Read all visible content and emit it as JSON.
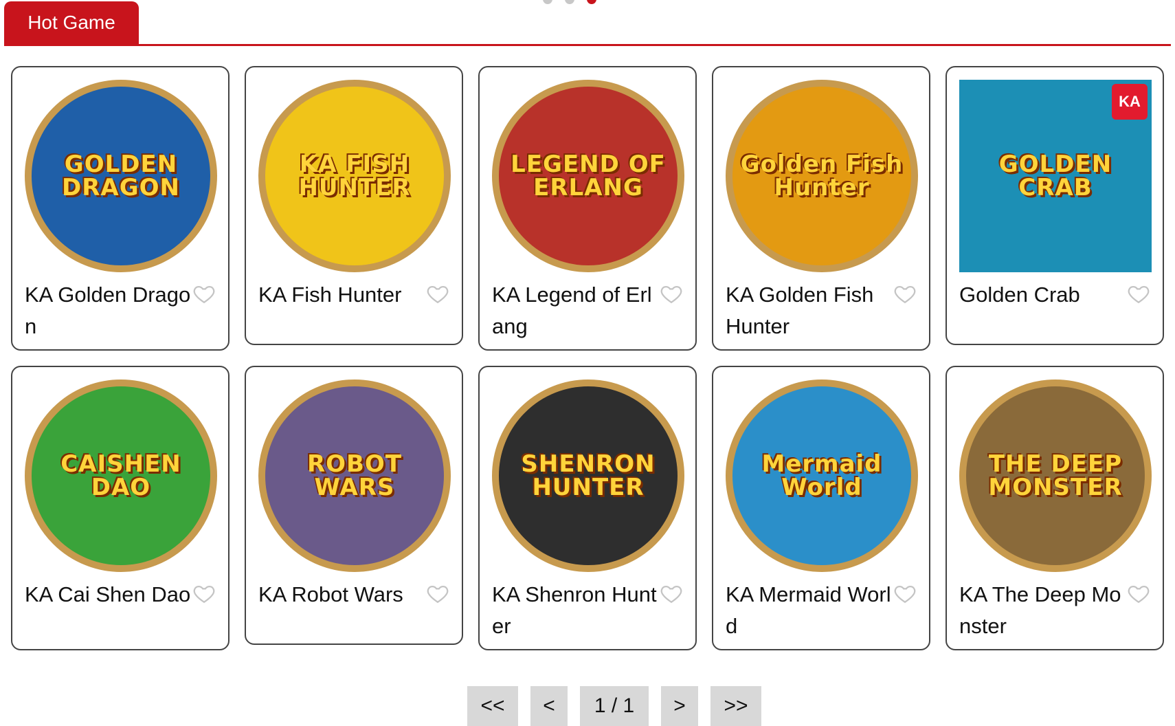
{
  "header": {
    "tab_label": "Hot Game",
    "accent": "#c8141c"
  },
  "games": [
    {
      "title": "KA Golden Dragon",
      "art_text": "GOLDEN DRAGON",
      "bg": "#1f5fa8"
    },
    {
      "title": "KA Fish Hunter",
      "art_text": "KA FISH HUNTER",
      "bg": "#f0c419"
    },
    {
      "title": "KA Legend of Erlang",
      "art_text": "LEGEND OF ERLANG",
      "bg": "#b8322a"
    },
    {
      "title": "KA Golden Fish Hunter",
      "art_text": "Golden Fish Hunter",
      "bg": "#e39a12"
    },
    {
      "title": "Golden Crab",
      "art_text": "GOLDEN CRAB",
      "bg": "#1c8fb5",
      "badge": "KA"
    },
    {
      "title": "KA Cai Shen Dao",
      "art_text": "CAISHEN DAO",
      "bg": "#3aa33a"
    },
    {
      "title": "KA Robot Wars",
      "art_text": "ROBOT WARS",
      "bg": "#6a5a8a"
    },
    {
      "title": "KA Shenron Hunter",
      "art_text": "SHENRON HUNTER",
      "bg": "#2e2e2e"
    },
    {
      "title": "KA Mermaid World",
      "art_text": "Mermaid World",
      "bg": "#2b8fc9"
    },
    {
      "title": "KA The Deep Monster",
      "art_text": "THE DEEP MONSTER",
      "bg": "#8a6a3a"
    }
  ],
  "pagination": {
    "first": "<<",
    "prev": "<",
    "page": "1 / 1",
    "next": ">",
    "last": ">>"
  }
}
